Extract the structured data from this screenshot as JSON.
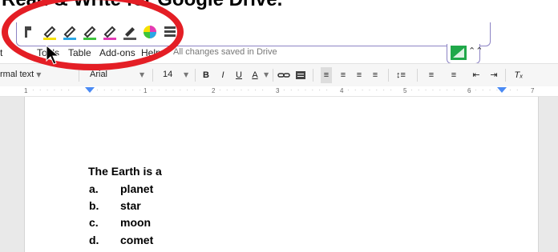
{
  "heading": "Read & Write for Google Drive.",
  "rw_toolbar": {
    "icons": [
      "cursor-hand-icon",
      "highlighter-yellow-icon",
      "highlighter-blue-icon",
      "highlighter-green-icon",
      "highlighter-pink-icon",
      "highlighter-eraser-icon",
      "collect-highlights-icon",
      "vocabulary-list-icon"
    ],
    "colors": {
      "yellow": "#f6e000",
      "blue": "#2aa7e6",
      "green": "#3cc43c",
      "pink": "#e43ab6",
      "border": "#8c83c4"
    }
  },
  "rw_tab": {
    "logo": "read-write-logo-icon",
    "toggle": "collapse-toolbar-icon"
  },
  "menu": {
    "items": [
      "t",
      "Tools",
      "Table",
      "Add-ons",
      "Help"
    ],
    "status": "All changes saved in Drive"
  },
  "format_toolbar": {
    "style": "rmal text",
    "font": "Arial",
    "size": "14",
    "bold": "B",
    "italic": "I",
    "underline": "U",
    "text_color": "A",
    "text_color_accent": "#000000"
  },
  "ruler": {
    "numbers": [
      "1",
      "1",
      "2",
      "3",
      "4",
      "5",
      "6",
      "7"
    ]
  },
  "document": {
    "question": "The Earth is a",
    "options": [
      {
        "marker": "a.",
        "text": "planet"
      },
      {
        "marker": "b.",
        "text": "star"
      },
      {
        "marker": "c.",
        "text": "moon"
      },
      {
        "marker": "d.",
        "text": "comet"
      }
    ]
  },
  "annotation": {
    "circle_color": "#e41e25"
  }
}
